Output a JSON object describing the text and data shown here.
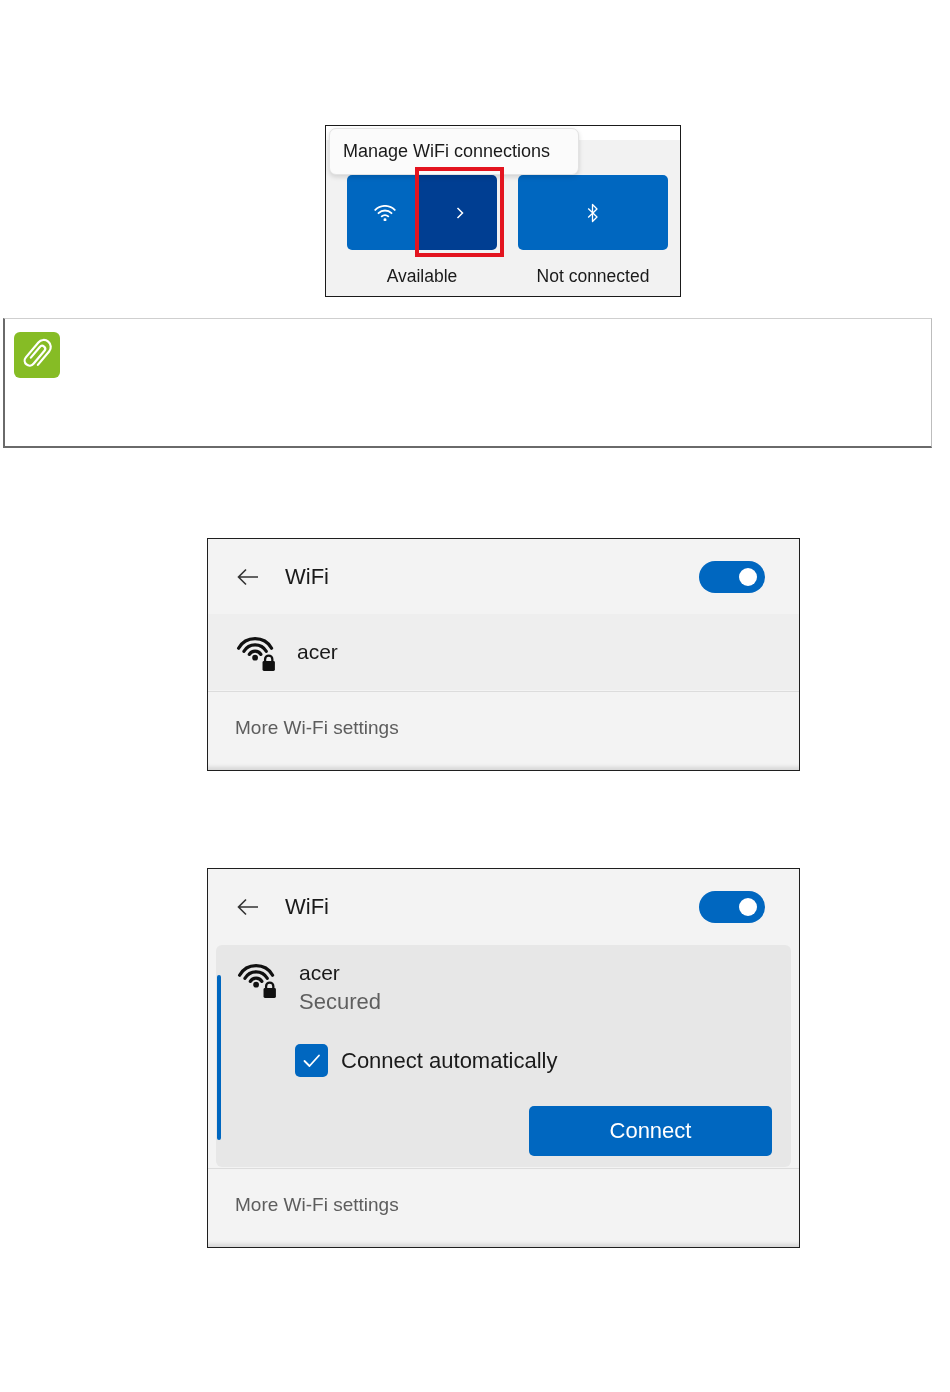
{
  "quick_settings": {
    "tooltip": "Manage WiFi connections",
    "tiles": [
      {
        "kind": "wifi",
        "on": true,
        "label": "Available",
        "expand": {
          "highlighted": true
        }
      },
      {
        "kind": "bluetooth",
        "on": true,
        "label": "Not connected"
      }
    ]
  },
  "wifi_panels": [
    {
      "title": "WiFi",
      "wifi_on": true,
      "networks": [
        {
          "name": "acer",
          "secured": true,
          "expanded": false
        }
      ],
      "settings_link": "More Wi-Fi settings"
    },
    {
      "title": "WiFi",
      "wifi_on": true,
      "networks": [
        {
          "name": "acer",
          "secured": true,
          "expanded": true,
          "status": "Secured",
          "auto_connect": {
            "label": "Connect automatically",
            "checked": true
          },
          "action": "Connect"
        }
      ],
      "settings_link": "More Wi-Fi settings"
    }
  ]
}
